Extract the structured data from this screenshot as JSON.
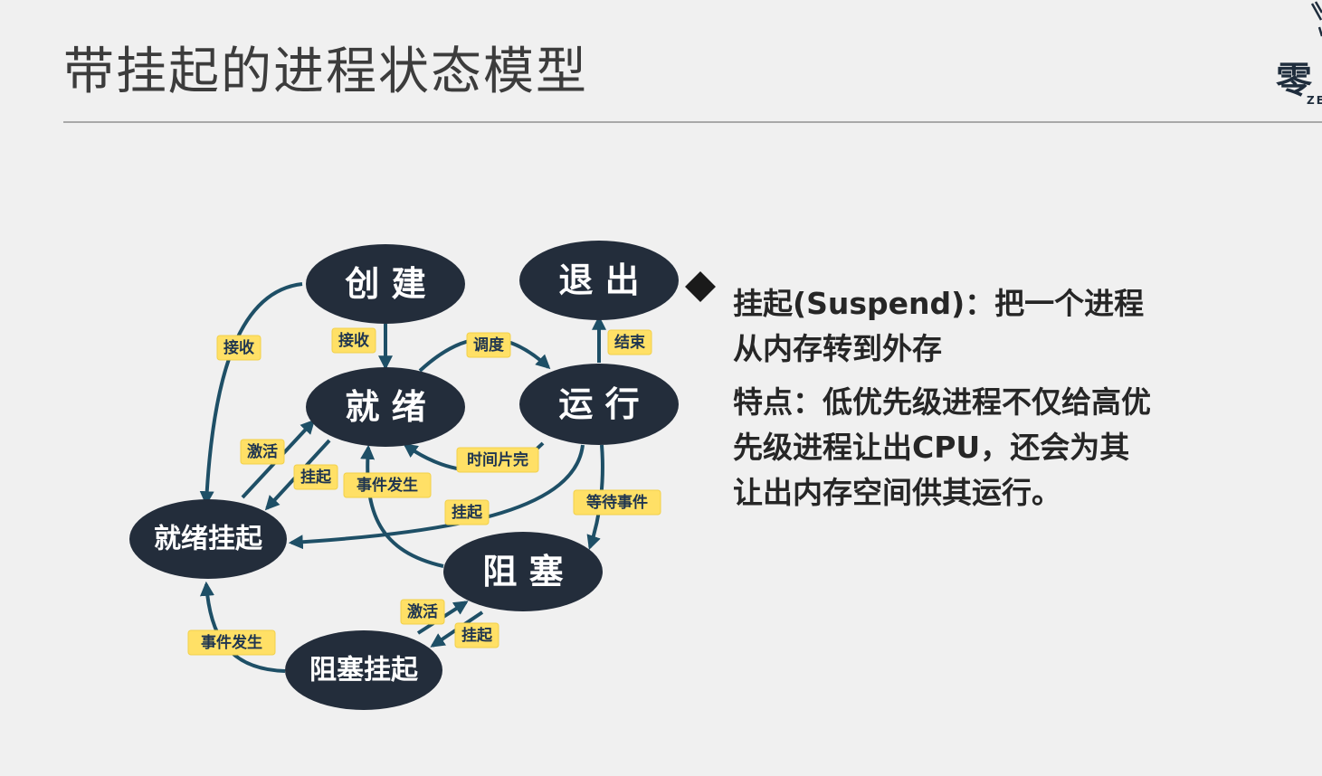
{
  "slide": {
    "title": "带挂起的进程状态模型"
  },
  "logo": {
    "char": "零",
    "sub": "ZE"
  },
  "diagram": {
    "nodes": {
      "create": "创 建",
      "exit": "退 出",
      "ready": "就 绪",
      "running": "运 行",
      "ready_suspend": "就绪挂起",
      "blocked": "阻 塞",
      "blocked_suspend": "阻塞挂起"
    },
    "labels": {
      "admit_left": "接收",
      "admit_down": "接收",
      "dispatch": "调度",
      "release": "结束",
      "activate_ready": "激活",
      "suspend_ready": "挂起",
      "timeout": "时间片完",
      "event_occurs": "事件发生",
      "suspend_running": "挂起",
      "event_wait": "等待事件",
      "activate_blocked": "激活",
      "suspend_blocked": "挂起",
      "event_occurs_suspended": "事件发生"
    },
    "colors": {
      "node_fill": "#232d3b",
      "edge": "#1e4f66",
      "tag_fill": "#ffe066"
    }
  },
  "text": {
    "line1": "挂起(Suspend)：把一个进程从内存转到外存",
    "line2": "特点：低优先级进程不仅给高优先级进程让出CPU，还会为其让出内存空间供其运行。"
  }
}
